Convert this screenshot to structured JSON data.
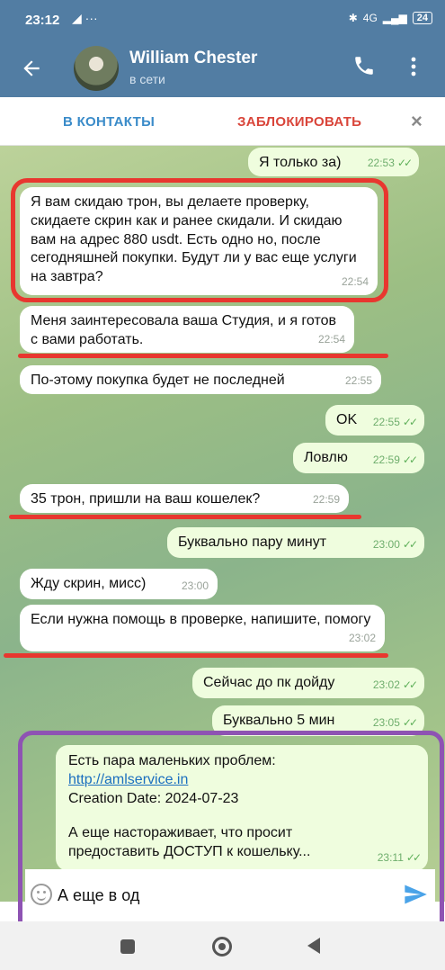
{
  "statusbar": {
    "time": "23:12",
    "left_icons": "◢ ···",
    "network": "4G",
    "battery": "24"
  },
  "header": {
    "title": "William Chester",
    "status": "в сети"
  },
  "actions": {
    "add_contact": "В КОНТАКТЫ",
    "block": "ЗАБЛОКИРОВАТЬ",
    "close": "×"
  },
  "messages": [
    {
      "dir": "out",
      "text": "Я только за)",
      "time": "22:53",
      "ticks": "✓✓"
    },
    {
      "dir": "in",
      "text": "Я вам скидаю трон, вы делаете проверку, скидаете скрин как и ранее скидали. И скидаю вам на адрес 880 usdt. Есть одно но, после сегодняшней покупки. Будут ли у вас еще услуги на завтра?",
      "time": "22:54"
    },
    {
      "dir": "in",
      "text": "Меня заинтересовала ваша Студия, и я готов с вами работать.",
      "time": "22:54"
    },
    {
      "dir": "in",
      "text": "По-этому покупка будет не последней",
      "time": "22:55"
    },
    {
      "dir": "out",
      "text": "OK",
      "time": "22:55",
      "ticks": "✓✓"
    },
    {
      "dir": "out",
      "text": "Ловлю",
      "time": "22:59",
      "ticks": "✓✓"
    },
    {
      "dir": "in",
      "text": "35 трон, пришли на ваш кошелек?",
      "time": "22:59"
    },
    {
      "dir": "out",
      "text": "Буквально пару минут",
      "time": "23:00",
      "ticks": "✓✓"
    },
    {
      "dir": "in",
      "text": "Жду скрин, мисс)",
      "time": "23:00"
    },
    {
      "dir": "in",
      "text": "Если нужна помощь в проверке, напишите, помогу",
      "time": "23:02"
    },
    {
      "dir": "out",
      "text": "Сейчас до пк дойду",
      "time": "23:02",
      "ticks": "✓✓"
    },
    {
      "dir": "out",
      "text": "Буквально 5 мин",
      "time": "23:05",
      "ticks": "✓✓"
    }
  ],
  "last_message": {
    "line1": "Есть пара маленьких проблем:",
    "link": "http://amlservice.in",
    "line3": "Creation Date: 2024-07-23",
    "line4": "А еще настораживает, что просит предоставить ДОСТУП к кошельку...",
    "time": "23:11",
    "ticks": "✓✓"
  },
  "input": {
    "value": "А еще в од"
  },
  "colors": {
    "header": "#527da3",
    "annotation_red": "#e8372f",
    "annotation_purple": "#8e53b3",
    "link": "#1b6fbf"
  },
  "icons": [
    "back-arrow-icon",
    "phone-icon",
    "more-vertical-icon",
    "close-icon",
    "emoji-icon",
    "send-icon"
  ]
}
